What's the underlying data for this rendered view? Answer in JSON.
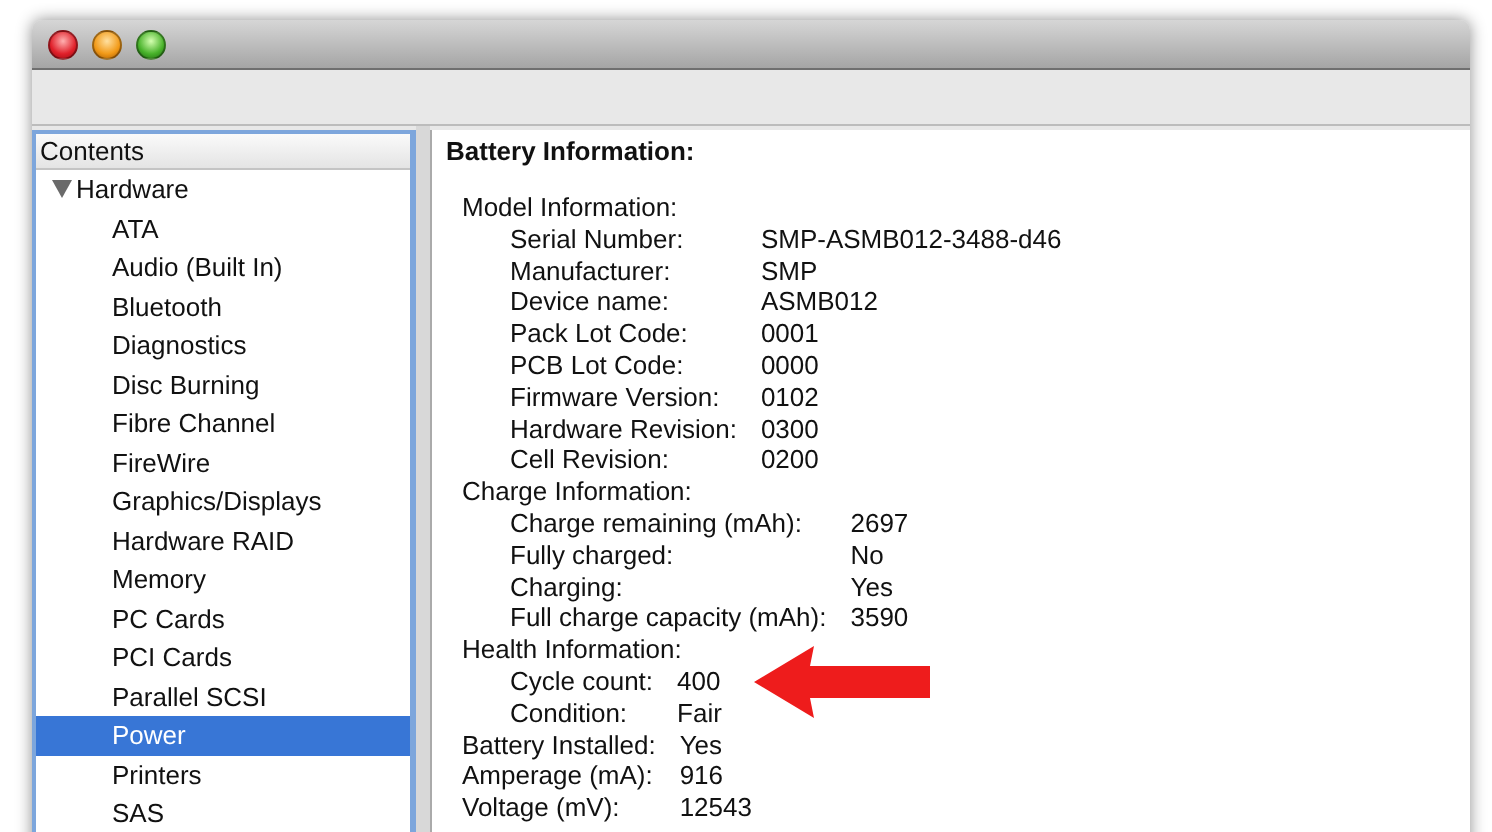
{
  "sidebar": {
    "header": "Contents",
    "tree": [
      {
        "label": "Hardware",
        "expanded": true,
        "selected": false,
        "children": [
          {
            "label": "ATA",
            "selected": false
          },
          {
            "label": "Audio (Built In)",
            "selected": false
          },
          {
            "label": "Bluetooth",
            "selected": false
          },
          {
            "label": "Diagnostics",
            "selected": false
          },
          {
            "label": "Disc Burning",
            "selected": false
          },
          {
            "label": "Fibre Channel",
            "selected": false
          },
          {
            "label": "FireWire",
            "selected": false
          },
          {
            "label": "Graphics/Displays",
            "selected": false
          },
          {
            "label": "Hardware RAID",
            "selected": false
          },
          {
            "label": "Memory",
            "selected": false
          },
          {
            "label": "PC Cards",
            "selected": false
          },
          {
            "label": "PCI Cards",
            "selected": false
          },
          {
            "label": "Parallel SCSI",
            "selected": false
          },
          {
            "label": "Power",
            "selected": true
          },
          {
            "label": "Printers",
            "selected": false
          },
          {
            "label": "SAS",
            "selected": false
          }
        ]
      }
    ]
  },
  "detail": {
    "title": "Battery Information:",
    "groups": [
      {
        "label": "Model Information:",
        "fields": [
          {
            "label": "Serial Number:",
            "value": "SMP-ASMB012-3488-d46"
          },
          {
            "label": "Manufacturer:",
            "value": "SMP"
          },
          {
            "label": "Device name:",
            "value": "ASMB012"
          },
          {
            "label": "Pack Lot Code:",
            "value": "0001"
          },
          {
            "label": "PCB Lot Code:",
            "value": "0000"
          },
          {
            "label": "Firmware Version:",
            "value": "0102"
          },
          {
            "label": "Hardware Revision:",
            "value": "0300"
          },
          {
            "label": "Cell Revision:",
            "value": "0200"
          }
        ]
      },
      {
        "label": "Charge Information:",
        "fields": [
          {
            "label": "Charge remaining (mAh):",
            "value": "2697"
          },
          {
            "label": "Fully charged:",
            "value": "No"
          },
          {
            "label": "Charging:",
            "value": "Yes"
          },
          {
            "label": "Full charge capacity (mAh):",
            "value": "3590"
          }
        ]
      },
      {
        "label": "Health Information:",
        "fields": [
          {
            "label": "Cycle count:",
            "value": "400"
          },
          {
            "label": "Condition:",
            "value": "Fair"
          }
        ]
      }
    ],
    "fields": [
      {
        "label": "Battery Installed:",
        "value": "Yes"
      },
      {
        "label": "Amperage (mA):",
        "value": "916"
      },
      {
        "label": "Voltage (mV):",
        "value": "12543"
      }
    ]
  }
}
